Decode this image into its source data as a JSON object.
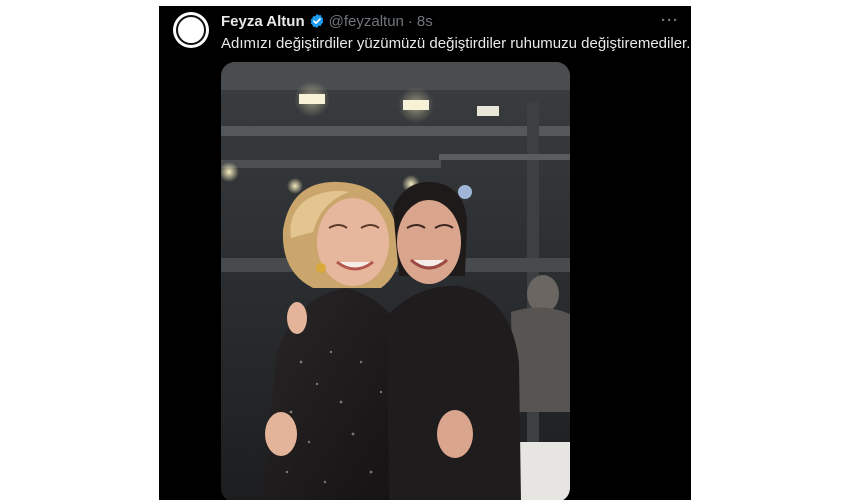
{
  "tweet": {
    "author_name": "Feyza Altun",
    "handle": "@feyzaltun",
    "separator": "·",
    "time": "8s",
    "more_label": "···",
    "text": "Adımızı değiştirdiler yüzümüzü değiştirdiler ruhumuzu değiştiremediler...."
  },
  "icons": {
    "avatar": "avatar-logo",
    "verified": "verified-badge-icon",
    "more": "more-options-icon"
  },
  "colors": {
    "background": "#000000",
    "primary_text": "#e7e9ea",
    "secondary_text": "#71767b",
    "verified": "#1d9bf0"
  }
}
